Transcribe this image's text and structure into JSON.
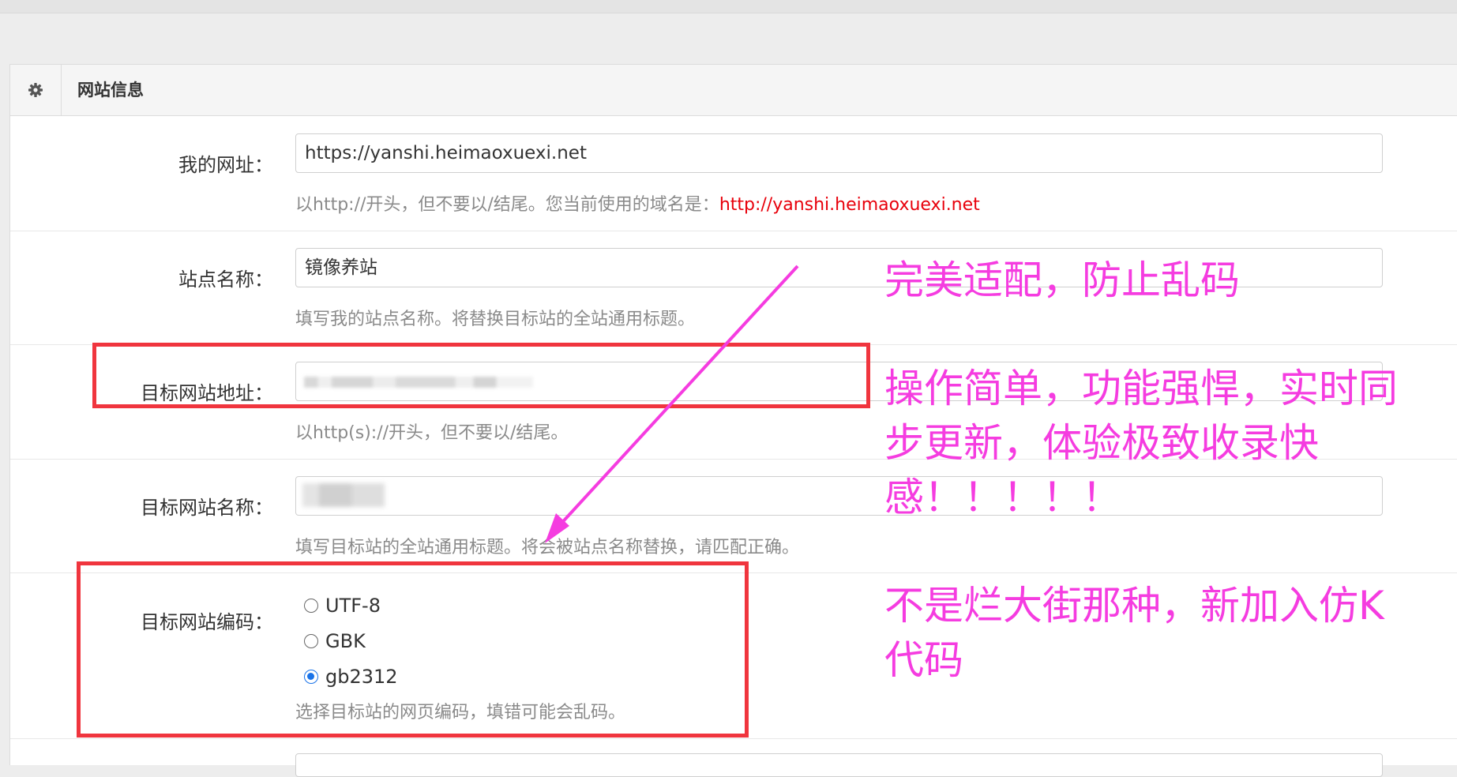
{
  "panel": {
    "title": "网站信息",
    "icon": "gear-icon"
  },
  "fields": {
    "my_url": {
      "label": "我的网址：",
      "value": "https://yanshi.heimaoxuexi.net",
      "help": "以http://开头，但不要以/结尾。您当前使用的域名是：",
      "help_link": "http://yanshi.heimaoxuexi.net"
    },
    "site_name": {
      "label": "站点名称：",
      "value": "镜像养站",
      "help": "填写我的站点名称。将替换目标站的全站通用标题。"
    },
    "target_url": {
      "label": "目标网站地址：",
      "help": "以http(s)://开头，但不要以/结尾。"
    },
    "target_name": {
      "label": "目标网站名称：",
      "help": "填写目标站的全站通用标题。将会被站点名称替换，请匹配正确。"
    },
    "target_encoding": {
      "label": "目标网站编码：",
      "options": [
        "UTF-8",
        "GBK",
        "gb2312"
      ],
      "selected": "gb2312",
      "help": "选择目标站的网页编码，填错可能会乱码。"
    }
  },
  "annotations": {
    "line1": "完美适配，防止乱码",
    "line2a": "操作简单，功能强悍，实时同",
    "line2b": "步更新，体验极致收录快",
    "line2c": "感！！！！！",
    "line3a": "不是烂大街那种，新加入仿K",
    "line3b": "代码"
  },
  "colors": {
    "annotation": "#f53ce0",
    "highlight_box": "#f0353e",
    "help_link": "#e8000b",
    "radio_checked": "#1a73e8"
  }
}
